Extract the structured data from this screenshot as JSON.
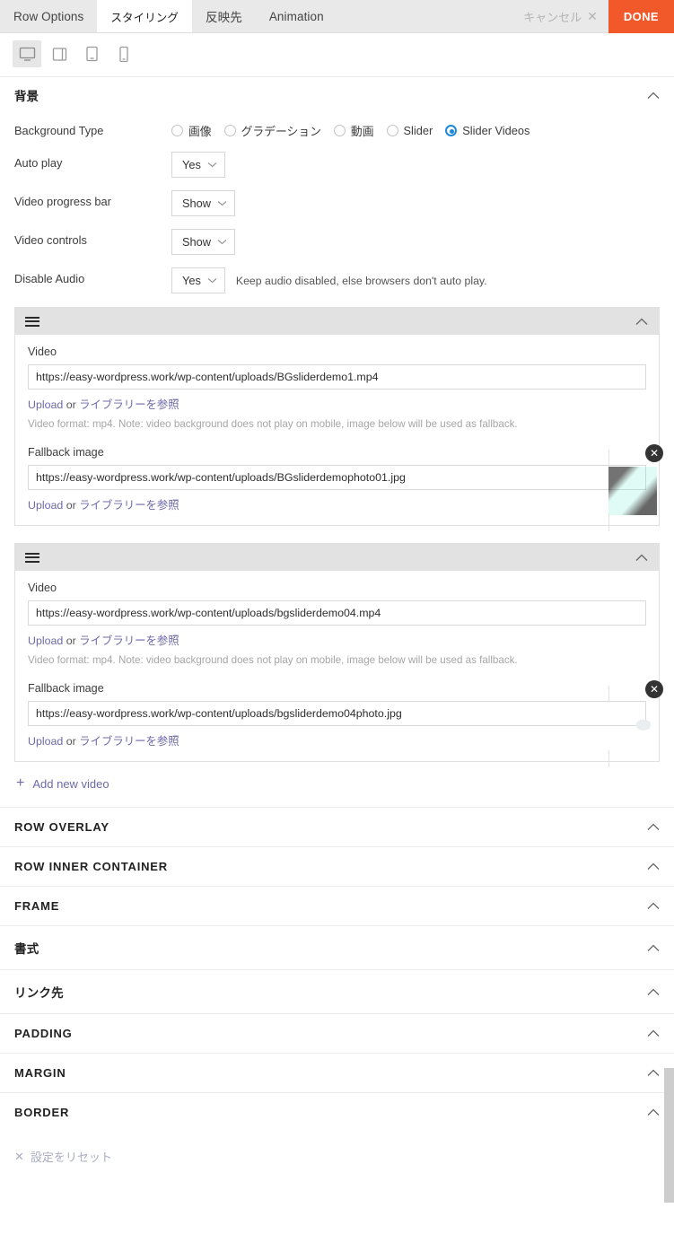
{
  "tabs": [
    {
      "label": "Row Options",
      "active": false
    },
    {
      "label": "スタイリング",
      "active": true
    },
    {
      "label": "反映先",
      "active": false
    },
    {
      "label": "Animation",
      "active": false
    }
  ],
  "header": {
    "cancel_label": "キャンセル",
    "cancel_icon": "close-icon",
    "done_label": "DONE",
    "done_color": "#f1592a"
  },
  "devices": [
    {
      "name": "desktop",
      "active": true
    },
    {
      "name": "laptop",
      "active": false
    },
    {
      "name": "tablet",
      "active": false
    },
    {
      "name": "mobile",
      "active": false
    }
  ],
  "background_section": {
    "title": "背景",
    "background_type": {
      "label": "Background Type",
      "options": [
        {
          "label": "画像",
          "checked": false
        },
        {
          "label": "グラデーション",
          "checked": false
        },
        {
          "label": "動画",
          "checked": false
        },
        {
          "label": "Slider",
          "checked": false
        },
        {
          "label": "Slider Videos",
          "checked": true
        }
      ],
      "accent": "#1e88d6"
    },
    "auto_play": {
      "label": "Auto play",
      "value": "Yes"
    },
    "video_progress_bar": {
      "label": "Video progress bar",
      "value": "Show"
    },
    "video_controls": {
      "label": "Video controls",
      "value": "Show"
    },
    "disable_audio": {
      "label": "Disable Audio",
      "value": "Yes",
      "hint": "Keep audio disabled, else browsers don't auto play."
    }
  },
  "video_items": [
    {
      "video_label": "Video",
      "video_url": "https://easy-wordpress.work/wp-content/uploads/BGsliderdemo1.mp4",
      "upload_label": "Upload",
      "or_label": " or ",
      "browse_label": "ライブラリーを参照",
      "note": "Video format: mp4. Note: video background does not play on mobile, image below will be used as fallback.",
      "fallback_label": "Fallback image",
      "fallback_url": "https://easy-wordpress.work/wp-content/uploads/BGsliderdemophoto01.jpg",
      "thumb_style": "thumb-a",
      "remove_icon": "close-icon"
    },
    {
      "video_label": "Video",
      "video_url": "https://easy-wordpress.work/wp-content/uploads/bgsliderdemo04.mp4",
      "upload_label": "Upload",
      "or_label": " or ",
      "browse_label": "ライブラリーを参照",
      "note": "Video format: mp4. Note: video background does not play on mobile, image below will be used as fallback.",
      "fallback_label": "Fallback image",
      "fallback_url": "https://easy-wordpress.work/wp-content/uploads/bgsliderdemo04photo.jpg",
      "thumb_style": "thumb-b",
      "remove_icon": "close-icon"
    }
  ],
  "add_new_video": {
    "label": "Add new video",
    "icon": "plus-icon"
  },
  "accordion_sections": [
    {
      "label": "ROW OVERLAY",
      "ja": false
    },
    {
      "label": "ROW INNER CONTAINER",
      "ja": false
    },
    {
      "label": "FRAME",
      "ja": false
    },
    {
      "label": "書式",
      "ja": true
    },
    {
      "label": "リンク先",
      "ja": true
    },
    {
      "label": "PADDING",
      "ja": false
    },
    {
      "label": "MARGIN",
      "ja": false
    },
    {
      "label": "BORDER",
      "ja": false
    }
  ],
  "reset": {
    "label": "設定をリセット",
    "icon": "close-icon"
  }
}
